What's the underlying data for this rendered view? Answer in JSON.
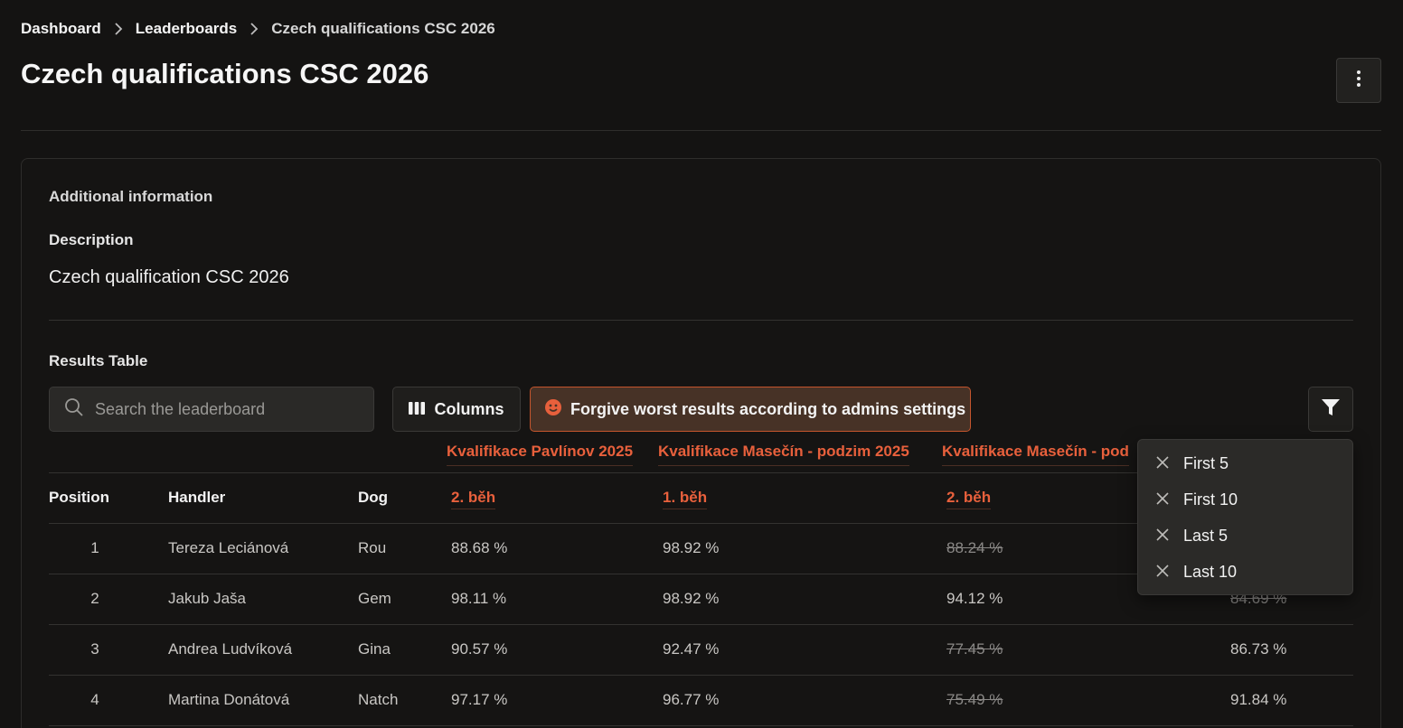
{
  "breadcrumb": {
    "items": [
      "Dashboard",
      "Leaderboards",
      "Czech qualifications CSC 2026"
    ]
  },
  "page": {
    "title": "Czech qualifications CSC 2026"
  },
  "info": {
    "section_title": "Additional information",
    "description_label": "Description",
    "description_text": "Czech qualification CSC 2026"
  },
  "results": {
    "title": "Results Table",
    "search_placeholder": "Search the leaderboard",
    "columns_label": "Columns",
    "forgive_label": "Forgive worst results according to admins settings",
    "column_groups": [
      "Kvalifikace Pavlínov 2025",
      "Kvalifikace Masečín - podzim 2025",
      "Kvalifikace Masečín - pod"
    ],
    "headers": {
      "position": "Position",
      "handler": "Handler",
      "dog": "Dog"
    },
    "runs": [
      "2. běh",
      "1. běh",
      "2. běh"
    ],
    "rows": [
      {
        "position": "1",
        "handler": "Tereza Leciánová",
        "dog": "Rou",
        "c1": "88.68 %",
        "c2": "98.92 %",
        "c3": "88.24 %",
        "c3_struck": true,
        "c4": "",
        "c4_struck": false
      },
      {
        "position": "2",
        "handler": "Jakub Jaša",
        "dog": "Gem",
        "c1": "98.11 %",
        "c2": "98.92 %",
        "c3": "94.12 %",
        "c3_struck": false,
        "c4": "84.69 %",
        "c4_struck": true
      },
      {
        "position": "3",
        "handler": "Andrea Ludvíková",
        "dog": "Gina",
        "c1": "90.57 %",
        "c2": "92.47 %",
        "c3": "77.45 %",
        "c3_struck": true,
        "c4": "86.73 %",
        "c4_struck": false
      },
      {
        "position": "4",
        "handler": "Martina Donátová",
        "dog": "Natch",
        "c1": "97.17 %",
        "c2": "96.77 %",
        "c3": "75.49 %",
        "c3_struck": true,
        "c4": "91.84 %",
        "c4_struck": false
      }
    ]
  },
  "filter_menu": {
    "items": [
      "First 5",
      "First 10",
      "Last 5",
      "Last 10"
    ]
  },
  "colors": {
    "accent": "#e8603c",
    "background": "#141312",
    "forgive_bg": "#473226"
  },
  "icons": [
    "chevron-right-icon",
    "kebab-menu-icon",
    "search-icon",
    "columns-icon",
    "smiley-icon",
    "filter-icon",
    "close-icon"
  ]
}
